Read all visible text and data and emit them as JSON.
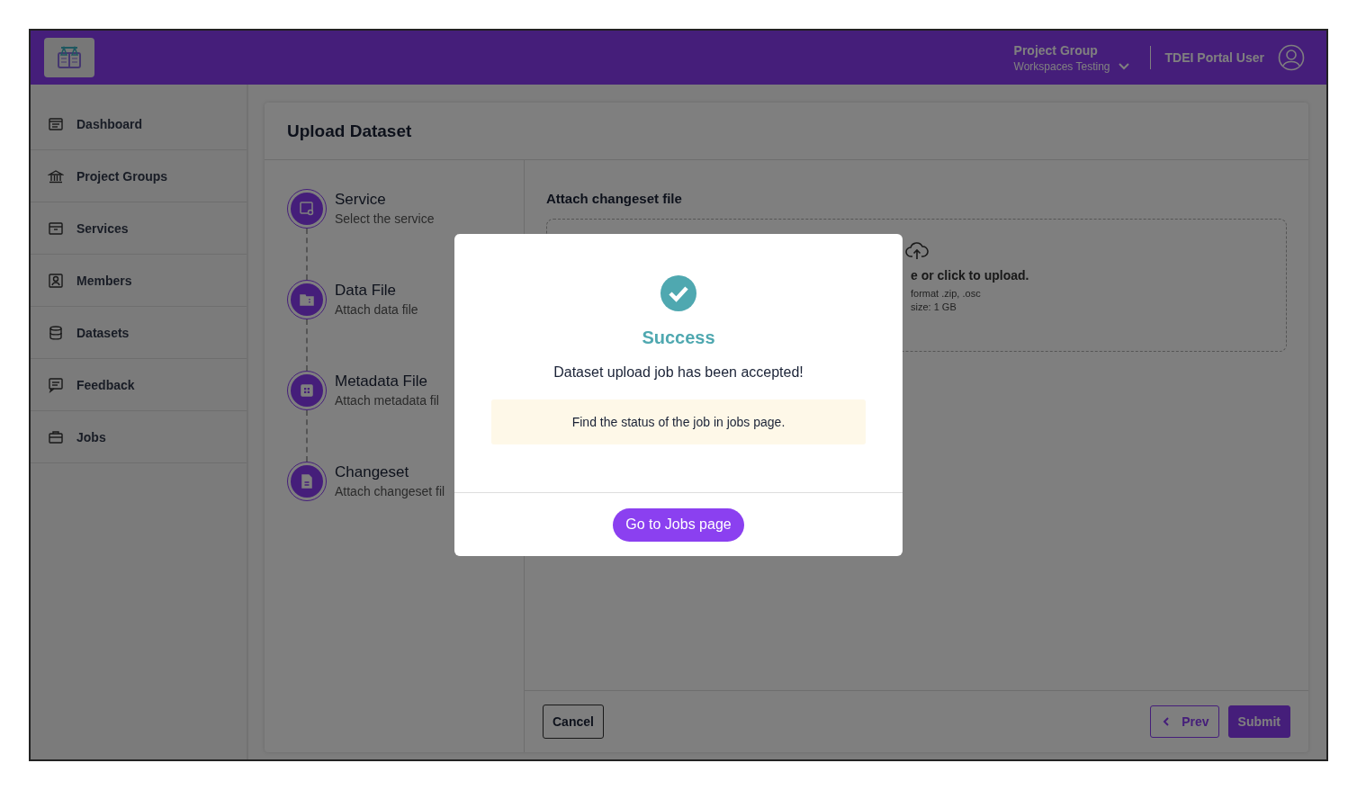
{
  "header": {
    "project_group": {
      "label": "Project Group",
      "value": "Workspaces Testing"
    },
    "user": "TDEI Portal User"
  },
  "sidebar": {
    "items": [
      {
        "label": "Dashboard"
      },
      {
        "label": "Project Groups"
      },
      {
        "label": "Services"
      },
      {
        "label": "Members"
      },
      {
        "label": "Datasets"
      },
      {
        "label": "Feedback"
      },
      {
        "label": "Jobs"
      }
    ]
  },
  "card": {
    "title": "Upload Dataset",
    "steps": [
      {
        "title": "Service",
        "subtitle": "Select the service"
      },
      {
        "title": "Data File",
        "subtitle": "Attach data file"
      },
      {
        "title": "Metadata File",
        "subtitle": "Attach metadata fil"
      },
      {
        "title": "Changeset",
        "subtitle": "Attach changeset fil"
      }
    ],
    "upload": {
      "heading": "Attach changeset file",
      "prompt": "e or click to upload.",
      "format": "format .zip, .osc",
      "size": "size: 1 GB"
    },
    "footer": {
      "cancel": "Cancel",
      "prev": "Prev",
      "submit": "Submit"
    }
  },
  "modal": {
    "title": "Success",
    "message": "Dataset upload job has been accepted!",
    "note": "Find the status of the job in jobs page.",
    "button": "Go to Jobs page"
  }
}
